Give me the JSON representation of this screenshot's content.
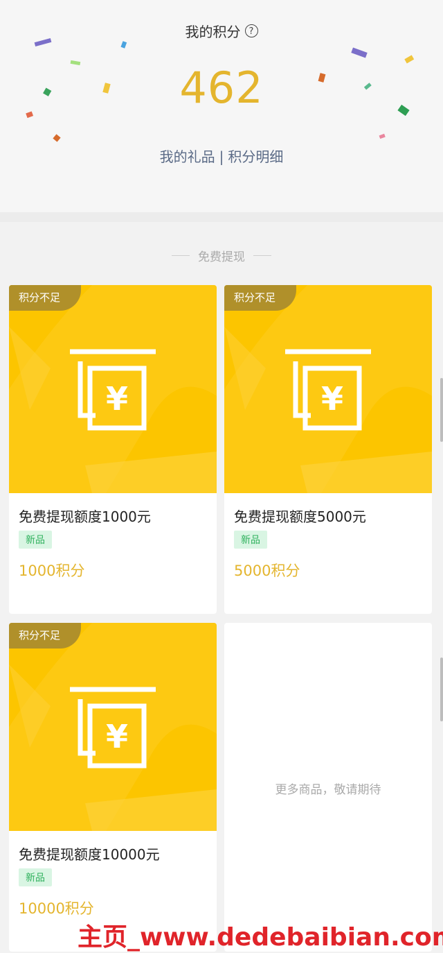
{
  "header": {
    "title": "我的积分",
    "help_icon": "?",
    "points": "462",
    "link_gifts": "我的礼品",
    "link_sep": "|",
    "link_detail": "积分明细"
  },
  "section": {
    "title": "免费提现"
  },
  "products": [
    {
      "badge": "积分不足",
      "name": "免费提现额度1000元",
      "tag": "新品",
      "price": "1000积分"
    },
    {
      "badge": "积分不足",
      "name": "免费提现额度5000元",
      "tag": "新品",
      "price": "5000积分"
    },
    {
      "badge": "积分不足",
      "name": "免费提现额度10000元",
      "tag": "新品",
      "price": "10000积分"
    }
  ],
  "empty_card": {
    "text": "更多商品，敬请期待"
  },
  "watermark": "主页_www.dedebaibian.com",
  "colors": {
    "accent": "#e4b52e",
    "card_bg": "#fcc500",
    "badge": "#b0902a",
    "tag_bg": "#d9f5e3",
    "tag_text": "#2fb15d"
  }
}
